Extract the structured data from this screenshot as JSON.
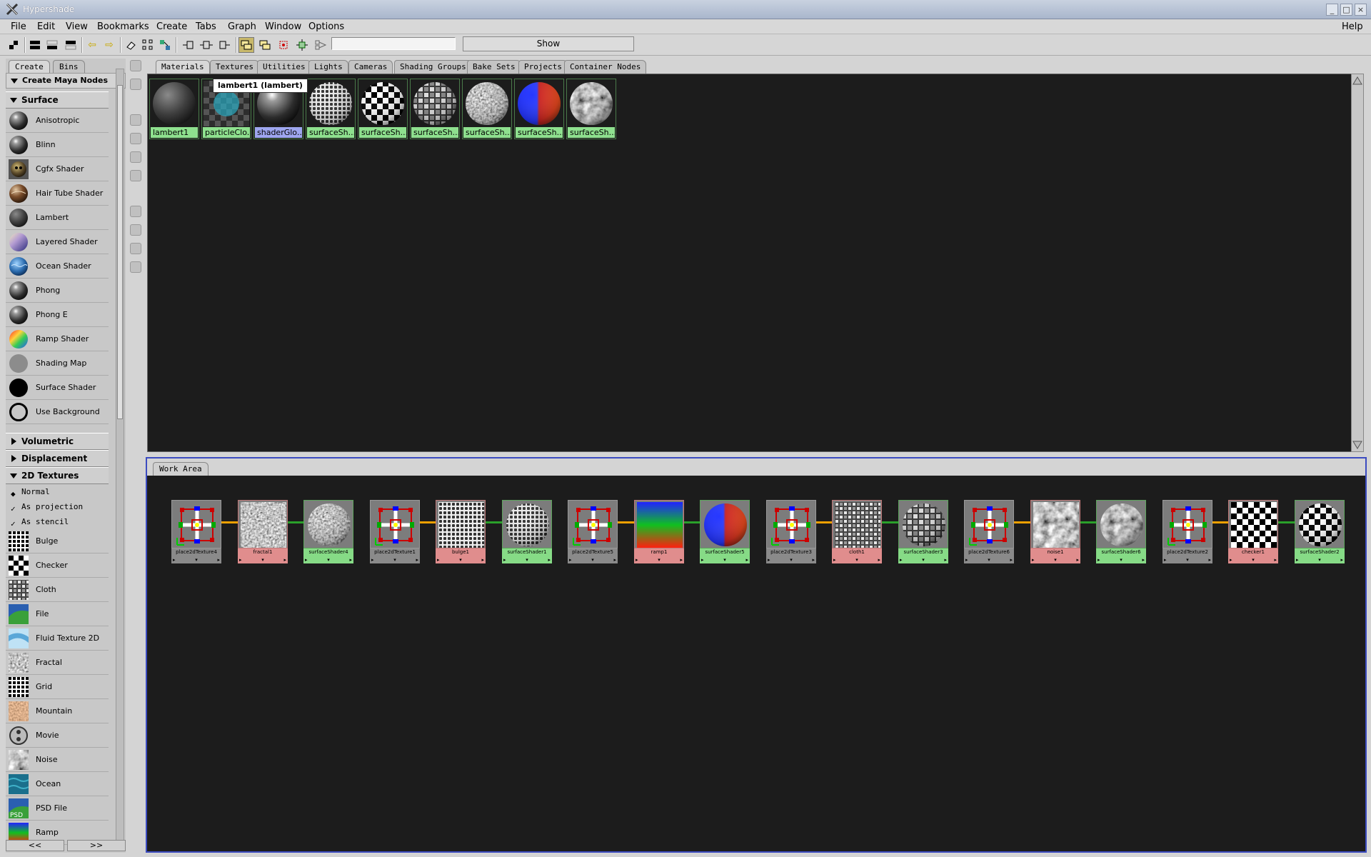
{
  "window": {
    "title": "Hypershade",
    "controls": [
      "_",
      "□",
      "×"
    ]
  },
  "menubar": {
    "items": [
      "File",
      "Edit",
      "View",
      "Bookmarks",
      "Create",
      "Tabs",
      "Graph",
      "Window",
      "Options"
    ],
    "help": "Help"
  },
  "toolbar": {
    "search_value": "",
    "show_label": "Show"
  },
  "left_panel": {
    "tabs": [
      "Create",
      "Bins"
    ],
    "header": "Create Maya Nodes",
    "sections": {
      "surface": {
        "label": "Surface",
        "items": [
          "Anisotropic",
          "Blinn",
          "Cgfx Shader",
          "Hair Tube Shader",
          "Lambert",
          "Layered Shader",
          "Ocean Shader",
          "Phong",
          "Phong E",
          "Ramp Shader",
          "Shading Map",
          "Surface Shader",
          "Use Background"
        ]
      },
      "volumetric": {
        "label": "Volumetric"
      },
      "displacement": {
        "label": "Displacement"
      },
      "textures2d": {
        "label": "2D Textures",
        "options": [
          "Normal",
          "As projection",
          "As stencil"
        ],
        "items": [
          "Bulge",
          "Checker",
          "Cloth",
          "File",
          "Fluid Texture 2D",
          "Fractal",
          "Grid",
          "Mountain",
          "Movie",
          "Noise",
          "Ocean",
          "PSD File",
          "Ramp"
        ]
      }
    },
    "scroll_left": "<<",
    "scroll_right": ">>",
    "psd_badge": "PSD"
  },
  "top_tabs": [
    "Materials",
    "Textures",
    "Utilities",
    "Lights",
    "Cameras",
    "Shading Groups",
    "Bake Sets",
    "Projects",
    "Container Nodes"
  ],
  "materials": [
    {
      "label": "lambert1",
      "kind": "lambert"
    },
    {
      "label": "particleClo...",
      "kind": "particle"
    },
    {
      "label": "shaderGlo...",
      "kind": "glow",
      "selected": true
    },
    {
      "label": "surfaceSh...",
      "kind": "bulge"
    },
    {
      "label": "surfaceSh...",
      "kind": "checker"
    },
    {
      "label": "surfaceSh...",
      "kind": "cloth"
    },
    {
      "label": "surfaceSh...",
      "kind": "fractal"
    },
    {
      "label": "surfaceSh...",
      "kind": "ramp"
    },
    {
      "label": "surfaceSh...",
      "kind": "noise"
    }
  ],
  "tooltip": "lambert1 (lambert)",
  "work_area": {
    "tab": "Work Area",
    "nodes": [
      {
        "name": "place2dTexture4",
        "kind": "place"
      },
      {
        "name": "fractal1",
        "kind": "fractal"
      },
      {
        "name": "surfaceShader4",
        "kind": "sph-fractal"
      },
      {
        "name": "place2dTexture1",
        "kind": "place"
      },
      {
        "name": "bulge1",
        "kind": "bulge"
      },
      {
        "name": "surfaceShader1",
        "kind": "sph-bulge"
      },
      {
        "name": "place2dTexture5",
        "kind": "place"
      },
      {
        "name": "ramp1",
        "kind": "ramp"
      },
      {
        "name": "surfaceShader5",
        "kind": "sph-ramp"
      },
      {
        "name": "place2dTexture3",
        "kind": "place"
      },
      {
        "name": "cloth1",
        "kind": "cloth"
      },
      {
        "name": "surfaceShader3",
        "kind": "sph-cloth"
      },
      {
        "name": "place2dTexture6",
        "kind": "place"
      },
      {
        "name": "noise1",
        "kind": "noise"
      },
      {
        "name": "surfaceShader6",
        "kind": "sph-noise"
      },
      {
        "name": "place2dTexture2",
        "kind": "place"
      },
      {
        "name": "checker1",
        "kind": "checker"
      },
      {
        "name": "surfaceShader2",
        "kind": "sph-checker"
      }
    ]
  },
  "colors": {
    "workspace": "#1c1c1c",
    "shader_label": "#8ee08e",
    "texture_label": "#e08d8d",
    "selected_label": "#9ea6ef",
    "work_area_border": "#3b4bc0",
    "connection_color": "#f0a000"
  }
}
